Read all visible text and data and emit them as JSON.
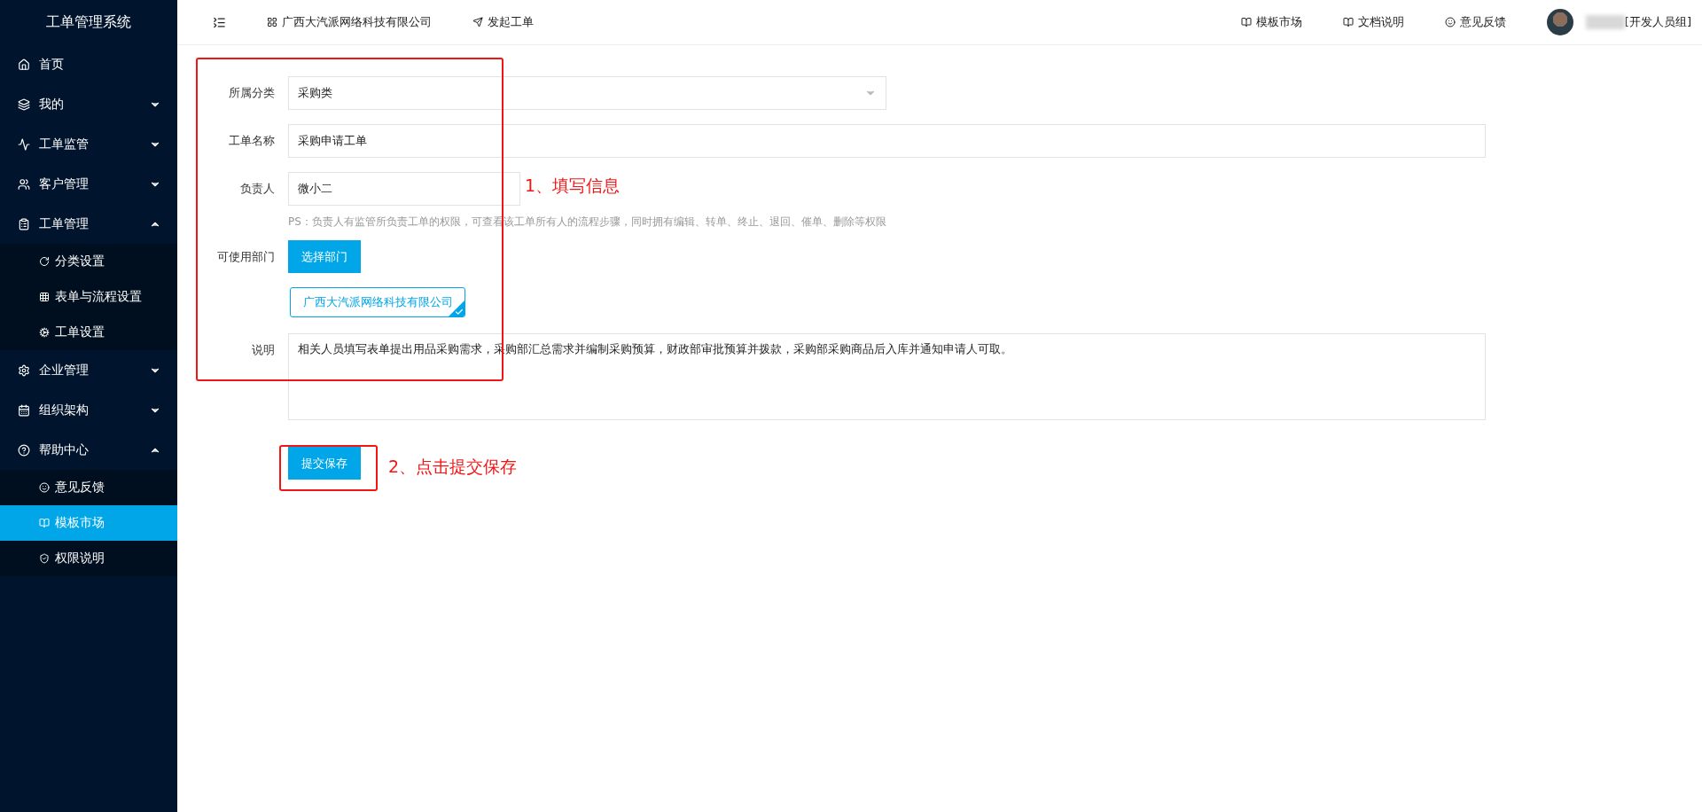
{
  "sidebar": {
    "title": "工单管理系统",
    "items": [
      {
        "label": "首页"
      },
      {
        "label": "我的",
        "expanded": false
      },
      {
        "label": "工单监管",
        "expanded": false
      },
      {
        "label": "客户管理",
        "expanded": false
      },
      {
        "label": "工单管理",
        "expanded": true,
        "children": [
          {
            "label": "分类设置",
            "selected": false
          },
          {
            "label": "表单与流程设置",
            "selected": false
          },
          {
            "label": "工单设置",
            "selected": false
          }
        ]
      },
      {
        "label": "企业管理",
        "expanded": false
      },
      {
        "label": "组织架构",
        "expanded": false
      },
      {
        "label": "帮助中心",
        "expanded": true,
        "children": [
          {
            "label": "意见反馈",
            "selected": false
          },
          {
            "label": "模板市场",
            "selected": true
          },
          {
            "label": "权限说明",
            "selected": false
          }
        ]
      }
    ]
  },
  "topbar": {
    "company": "广西大汽派网络科技有限公司",
    "new_ticket": "发起工单",
    "links": [
      "模板市场",
      "文档说明",
      "意见反馈"
    ],
    "user_group": "[开发人员组]"
  },
  "form": {
    "category": {
      "label": "所属分类",
      "value": "采购类"
    },
    "name": {
      "label": "工单名称",
      "value": "采购申请工单"
    },
    "owner": {
      "label": "负责人",
      "value": "微小二"
    },
    "owner_hint": "PS：负责人有监管所负责工单的权限，可查看该工单所有人的流程步骤，同时拥有编辑、转单、终止、退回、催单、删除等权限",
    "departments": {
      "label": "可使用部门",
      "button": "选择部门",
      "tags": [
        {
          "label": "广西大汽派网络科技有限公司",
          "selected": true
        }
      ]
    },
    "description": {
      "label": "说明",
      "value": "相关人员填写表单提出用品采购需求，采购部汇总需求并编制采购预算，财政部审批预算并拨款，采购部采购商品后入库并通知申请人可取。"
    },
    "submit": "提交保存"
  },
  "annotations": [
    "1、填写信息",
    "2、点击提交保存"
  ]
}
